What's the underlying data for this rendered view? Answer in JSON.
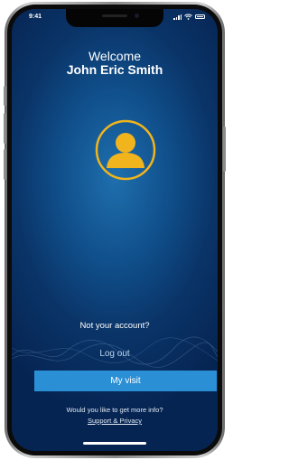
{
  "status_bar": {
    "time": "9:41",
    "icons": [
      "signal-icon",
      "wifi-icon",
      "battery-icon"
    ]
  },
  "header": {
    "welcome": "Welcome",
    "user_name": "John Eric Smith"
  },
  "avatar": {
    "icon": "user-avatar-icon",
    "ring_color": "#f2b41c",
    "fill_color": "#f2b41c"
  },
  "account": {
    "prompt": "Not your account?",
    "logout_label": "Log out"
  },
  "primary_button": {
    "label": "My visit",
    "color": "#2b8fd6"
  },
  "footer": {
    "question": "Would you like to get more info?",
    "link_label": "Support & Privacy"
  },
  "colors": {
    "background": "#0a3468",
    "accent": "#2b8fd6",
    "avatar": "#f2b41c"
  }
}
